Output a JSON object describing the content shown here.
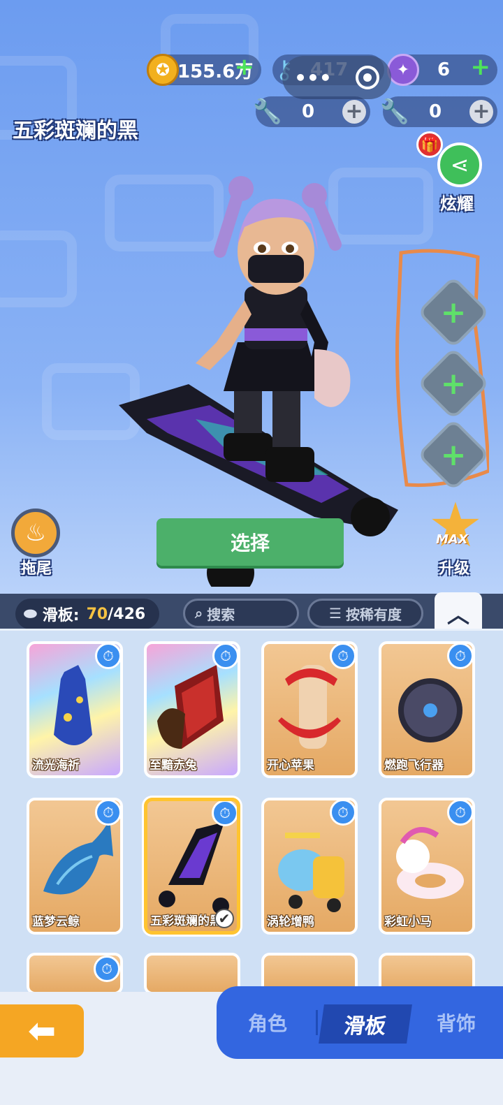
{
  "currency": {
    "coins": "155.6万",
    "keys": "417",
    "gems": "6",
    "wrench_silver": "0",
    "wrench_gold": "0"
  },
  "item_title": "五彩斑斓的黑",
  "share_label": "炫耀",
  "trail_label": "拖尾",
  "upgrade_label": "升级",
  "max_badge": "MAX",
  "select_button": "选择",
  "toolbar": {
    "count_label": "滑板:",
    "owned": "70",
    "total": "/426",
    "search_placeholder": "搜索",
    "sort_label": "按稀有度"
  },
  "cards": [
    {
      "name": "流光海祈",
      "timer": true,
      "bg": "rainbow"
    },
    {
      "name": "至黯赤兔",
      "timer": true,
      "bg": "rainbow"
    },
    {
      "name": "开心苹果",
      "timer": true,
      "bg": "orange"
    },
    {
      "name": "燃跑飞行器",
      "timer": true,
      "bg": "orange"
    },
    {
      "name": "蓝梦云鲸",
      "timer": true,
      "bg": "orange"
    },
    {
      "name": "五彩斑斓的黑",
      "timer": true,
      "bg": "orange",
      "selected": true
    },
    {
      "name": "涡轮增鸭",
      "timer": true,
      "bg": "orange"
    },
    {
      "name": "彩虹小马",
      "timer": true,
      "bg": "orange"
    }
  ],
  "tabs": {
    "character": "角色",
    "skateboard": "滑板",
    "accessory": "背饰"
  },
  "colors": {
    "accent_green": "#4cb06a",
    "tab_blue": "#3366e0",
    "back_orange": "#f5a623"
  }
}
